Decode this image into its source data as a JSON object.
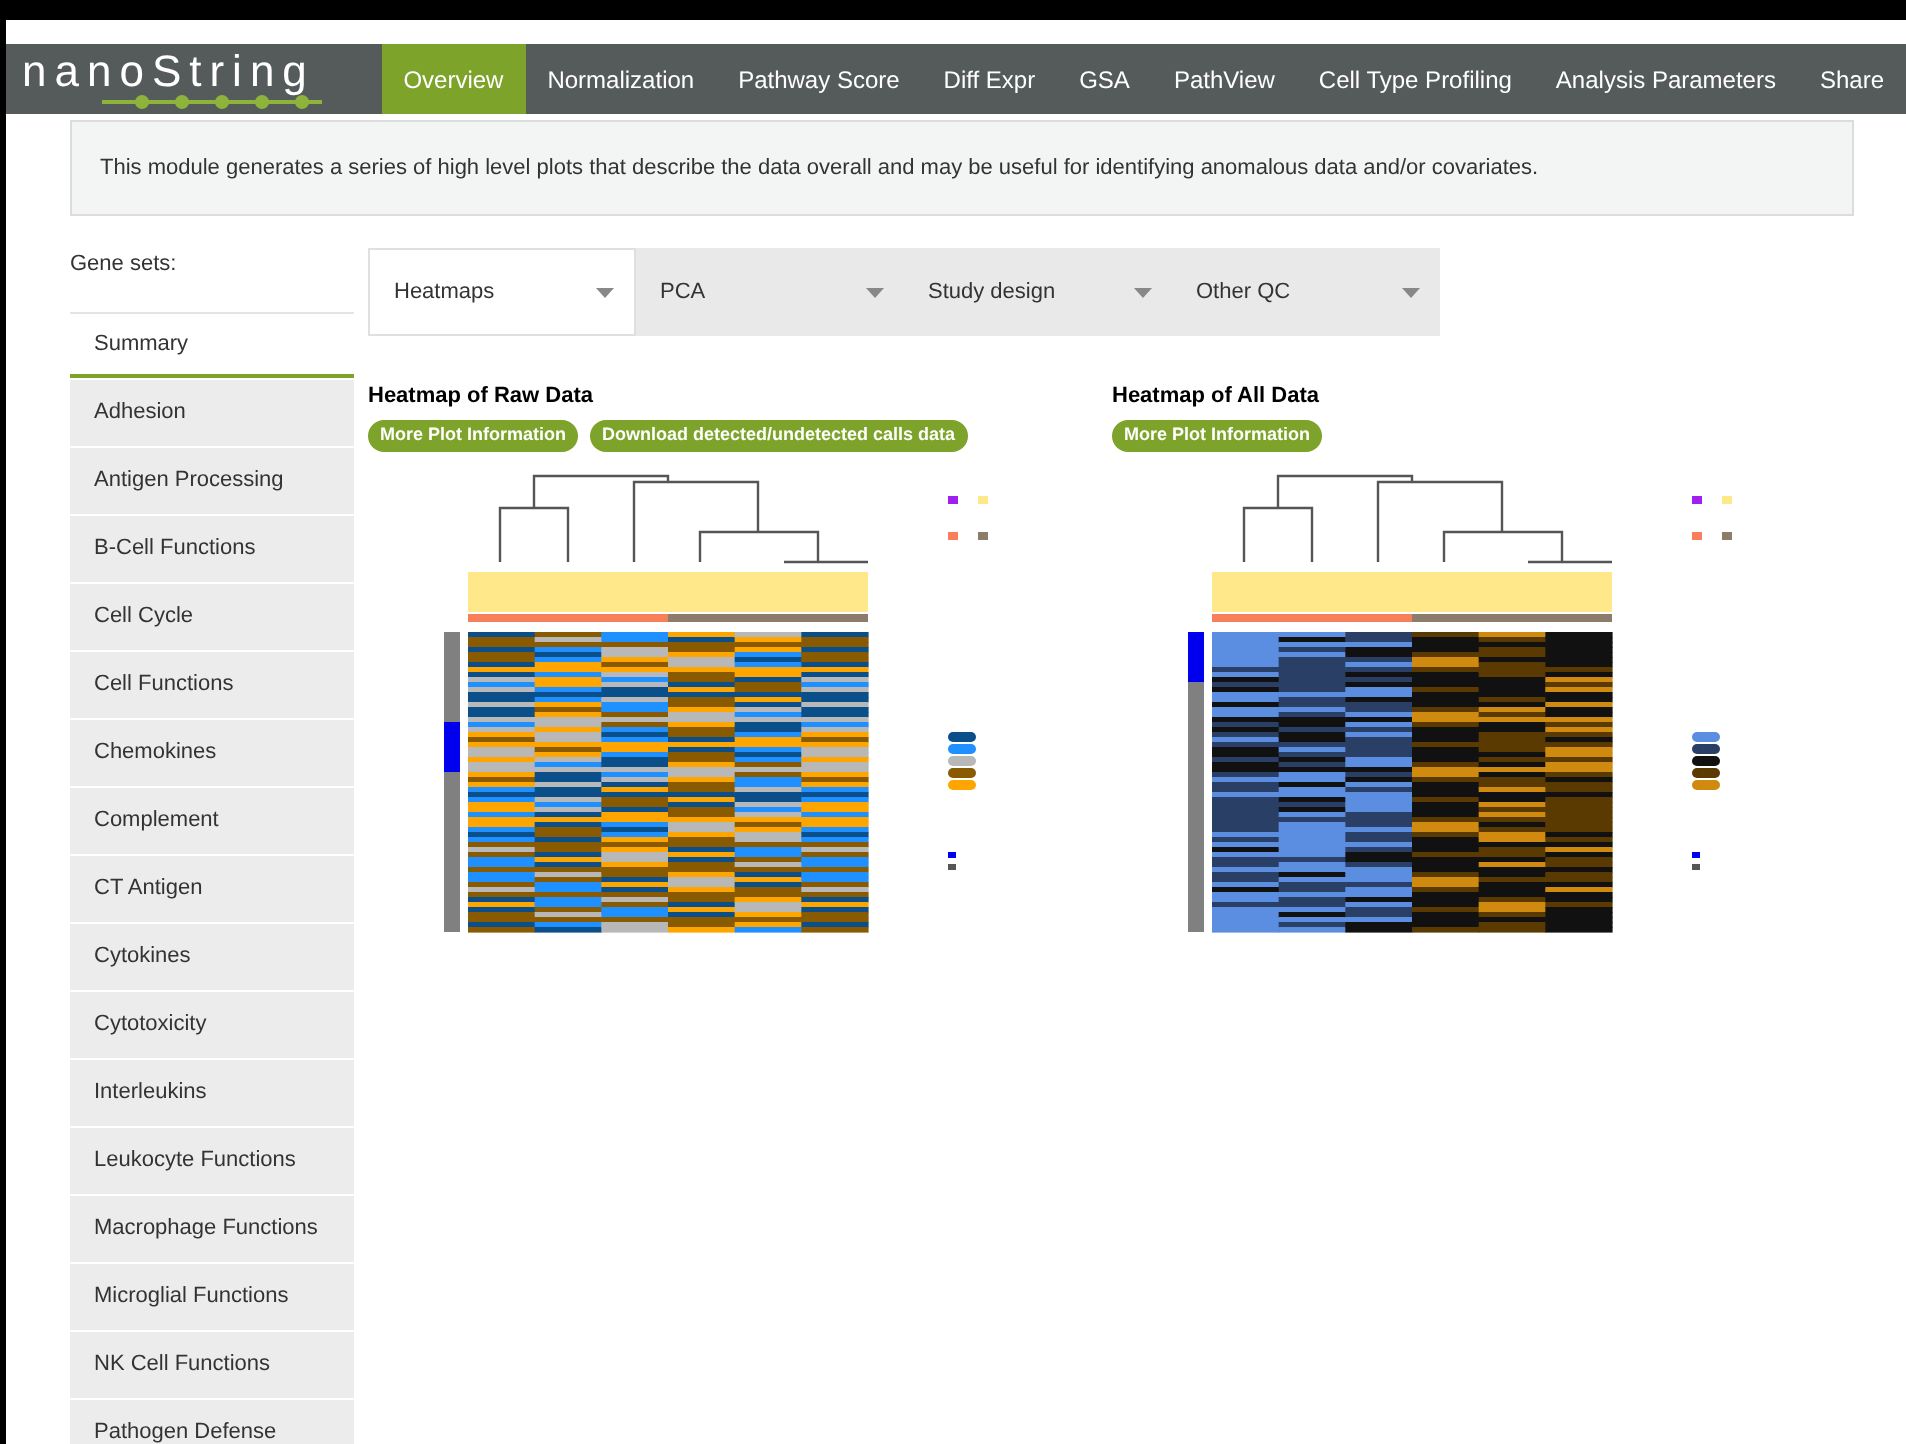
{
  "logo": {
    "text": "nanoString"
  },
  "nav": [
    {
      "label": "Overview",
      "selected": true
    },
    {
      "label": "Normalization",
      "selected": false
    },
    {
      "label": "Pathway Score",
      "selected": false
    },
    {
      "label": "Diff Expr",
      "selected": false
    },
    {
      "label": "GSA",
      "selected": false
    },
    {
      "label": "PathView",
      "selected": false
    },
    {
      "label": "Cell Type Profiling",
      "selected": false
    },
    {
      "label": "Analysis Parameters",
      "selected": false
    },
    {
      "label": "Share",
      "selected": false
    }
  ],
  "info": "This module generates a series of high level plots that describe the data overall and may be useful for identifying anomalous data and/or covariates.",
  "gene_sets": {
    "label": "Gene sets:",
    "items": [
      {
        "label": "Summary",
        "selected": true
      },
      {
        "label": "Adhesion",
        "selected": false
      },
      {
        "label": "Antigen Processing",
        "selected": false
      },
      {
        "label": "B-Cell Functions",
        "selected": false
      },
      {
        "label": "Cell Cycle",
        "selected": false
      },
      {
        "label": "Cell Functions",
        "selected": false
      },
      {
        "label": "Chemokines",
        "selected": false
      },
      {
        "label": "Complement",
        "selected": false
      },
      {
        "label": "CT Antigen",
        "selected": false
      },
      {
        "label": "Cytokines",
        "selected": false
      },
      {
        "label": "Cytotoxicity",
        "selected": false
      },
      {
        "label": "Interleukins",
        "selected": false
      },
      {
        "label": "Leukocyte Functions",
        "selected": false
      },
      {
        "label": "Macrophage Functions",
        "selected": false
      },
      {
        "label": "Microglial Functions",
        "selected": false
      },
      {
        "label": "NK Cell Functions",
        "selected": false
      },
      {
        "label": "Pathogen Defense",
        "selected": false
      }
    ]
  },
  "tabs": [
    {
      "label": "Heatmaps",
      "selected": true
    },
    {
      "label": "PCA",
      "selected": false
    },
    {
      "label": "Study design",
      "selected": false
    },
    {
      "label": "Other QC",
      "selected": false
    }
  ],
  "plots": [
    {
      "title": "Heatmap of Raw Data",
      "kind": "counts",
      "buttons": [
        "More Plot Information",
        "Download detected/undetected calls data"
      ]
    },
    {
      "title": "Heatmap of All Data",
      "kind": "scaled",
      "buttons": [
        "More Plot Information"
      ]
    }
  ]
}
